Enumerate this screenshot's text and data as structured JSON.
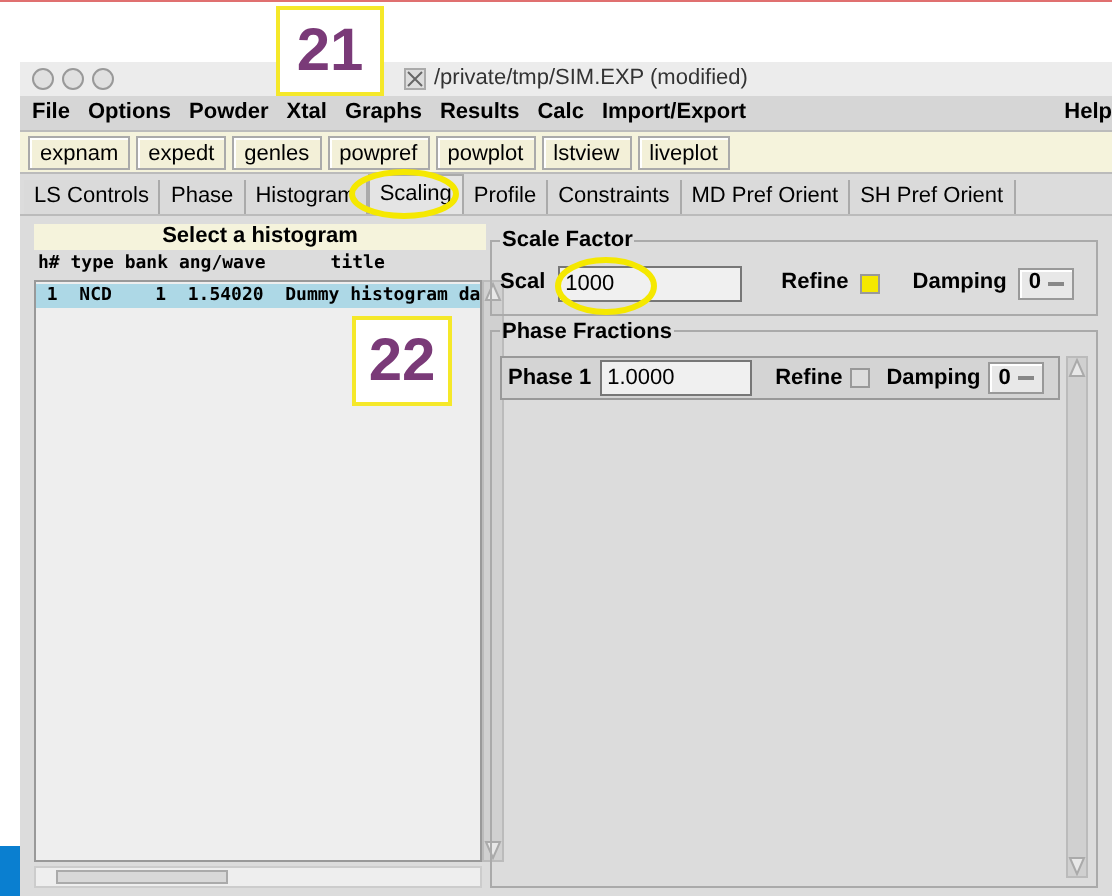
{
  "callouts": [
    "21",
    "22"
  ],
  "window": {
    "title": "/private/tmp/SIM.EXP (modified)"
  },
  "menu": [
    "File",
    "Options",
    "Powder",
    "Xtal",
    "Graphs",
    "Results",
    "Calc",
    "Import/Export"
  ],
  "help_menu": "Help",
  "toolbar": [
    "expnam",
    "expedt",
    "genles",
    "powpref",
    "powplot",
    "lstview",
    "liveplot"
  ],
  "tabs": [
    {
      "label": "LS Controls",
      "selected": false
    },
    {
      "label": "Phase",
      "selected": false
    },
    {
      "label": "Histogram",
      "selected": false
    },
    {
      "label": "Scaling",
      "selected": true
    },
    {
      "label": "Profile",
      "selected": false
    },
    {
      "label": "Constraints",
      "selected": false
    },
    {
      "label": "MD Pref Orient",
      "selected": false
    },
    {
      "label": "SH Pref Orient",
      "selected": false
    }
  ],
  "histogram_list": {
    "title": "Select a histogram",
    "columns": "h# type bank ang/wave      title",
    "rows": [
      {
        "text": " 1  NCD    1  1.54020  Dummy histogram da",
        "selected": true
      }
    ]
  },
  "scale_factor": {
    "title": "Scale Factor",
    "label": "Scal",
    "value": "1000",
    "refine_label": "Refine",
    "refine": true,
    "damping_label": "Damping",
    "damping": "0"
  },
  "phase_fractions": {
    "title": "Phase Fractions",
    "rows": [
      {
        "label": "Phase 1",
        "value": "1.0000",
        "refine_label": "Refine",
        "refine": false,
        "damping_label": "Damping",
        "damping": "0"
      }
    ]
  }
}
